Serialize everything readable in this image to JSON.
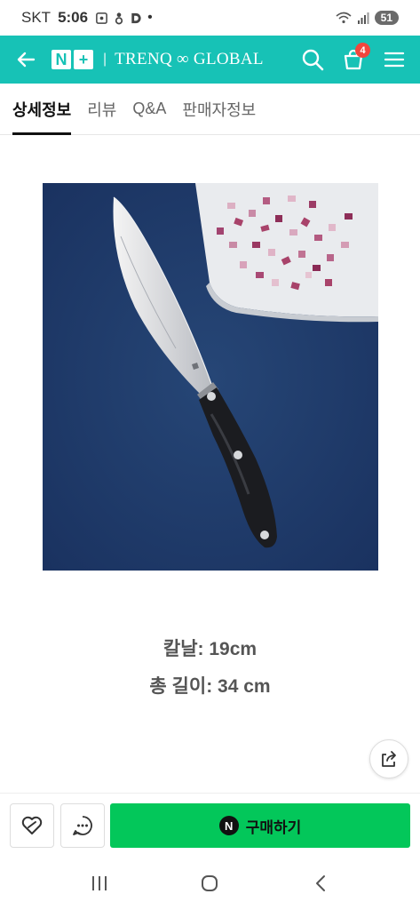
{
  "status_bar": {
    "carrier": "SKT",
    "time": "5:06",
    "battery": "51"
  },
  "header": {
    "logo_n": "N",
    "logo_plus": "+",
    "separator": "|",
    "brand": "TRENQ ∞ GLOBAL",
    "cart_count": "4"
  },
  "tabs": [
    {
      "label": "상세정보",
      "active": true
    },
    {
      "label": "리뷰",
      "active": false
    },
    {
      "label": "Q&A",
      "active": false
    },
    {
      "label": "판매자정보",
      "active": false
    }
  ],
  "specs": {
    "blade": "칼날: 19cm",
    "total_length": "총 길이: 34 cm"
  },
  "purchase": {
    "buy_label": "구매하기",
    "npay_letter": "N"
  },
  "colors": {
    "header": "#17c2b6",
    "buy": "#03c75a",
    "badge": "#f1463d",
    "image_bg": "#1f3b6b"
  },
  "icons": [
    "back-arrow-icon",
    "search-icon",
    "cart-icon",
    "menu-icon",
    "share-icon",
    "heart-icon",
    "chat-icon",
    "recent-apps-icon",
    "home-icon",
    "nav-back-icon"
  ]
}
